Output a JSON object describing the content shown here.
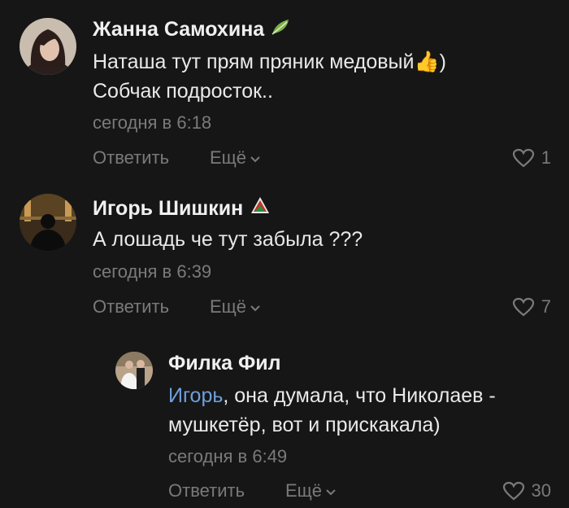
{
  "comments": [
    {
      "author": "Жанна Самохина",
      "badge_icon": "leaf-icon",
      "lines": [
        "Наташа тут прям пряник медовый",
        "Собчак подросток.."
      ],
      "emoji_after_line1": "👍",
      "line1_suffix": ")",
      "time": "сегодня в 6:18",
      "reply_label": "Ответить",
      "more_label": "Ещё",
      "likes": "1"
    },
    {
      "author": "Игорь Шишкин",
      "badge_icon": "lokomotiv-logo-icon",
      "text": "А лошадь че тут забыла ???",
      "time": "сегодня в 6:39",
      "reply_label": "Ответить",
      "more_label": "Ещё",
      "likes": "7"
    },
    {
      "author": "Филка Фил",
      "mention": "Игорь",
      "text_rest": ", она думала, что Николаев -",
      "text_line2": "мушкетёр, вот и прискакала)",
      "time": "сегодня в 6:49",
      "reply_label": "Ответить",
      "more_label": "Ещё",
      "likes": "30"
    }
  ],
  "colors": {
    "background": "#161616",
    "muted": "#7a7a7a",
    "mention": "#6f9fdc"
  }
}
